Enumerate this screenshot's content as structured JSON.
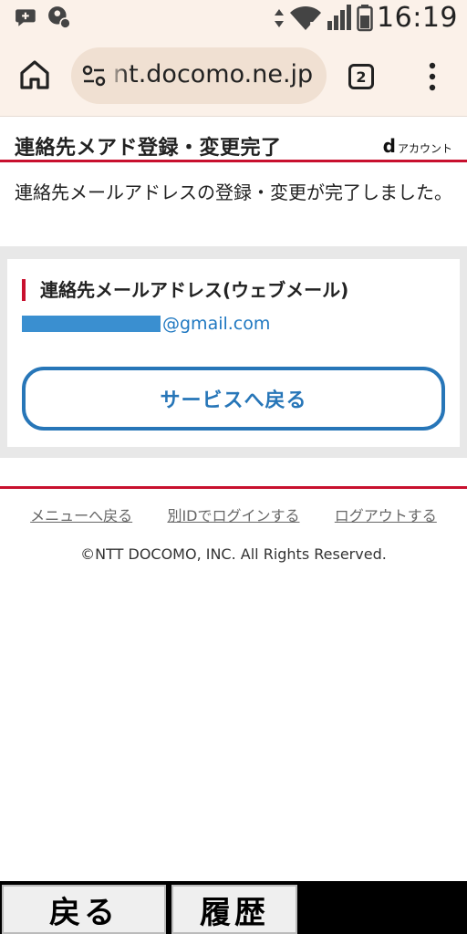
{
  "status_bar": {
    "time": "16:19",
    "icons": [
      "chat-bubble-plus-icon",
      "account-settings-icon",
      "wifi-icon",
      "signal-icon",
      "battery-icon"
    ]
  },
  "browser": {
    "url": "nt.docomo.ne.jp",
    "tab_count": "2",
    "icons": [
      "home-icon",
      "site-settings-icon",
      "tabs-icon",
      "more-menu-icon"
    ]
  },
  "page": {
    "title": "連絡先メアド登録・変更完了",
    "brand_d": "d",
    "brand_text": "アカウント",
    "message": "連絡先メールアドレスの登録・変更が完了しました。",
    "email_label": "連絡先メールアドレス(ウェブメール)",
    "email_domain": "@gmail.com",
    "back_button": "サービスへ戻る"
  },
  "footer": {
    "links": [
      "メニューへ戻る",
      "別IDでログインする",
      "ログアウトする"
    ],
    "copyright": "©NTT DOCOMO, INC. All Rights Reserved."
  },
  "bottom_nav": {
    "back": "戻る",
    "history": "履歴"
  },
  "colors": {
    "accent_red": "#c8102e",
    "link_blue": "#2776b8",
    "chrome_bg": "#fbf1e9"
  }
}
